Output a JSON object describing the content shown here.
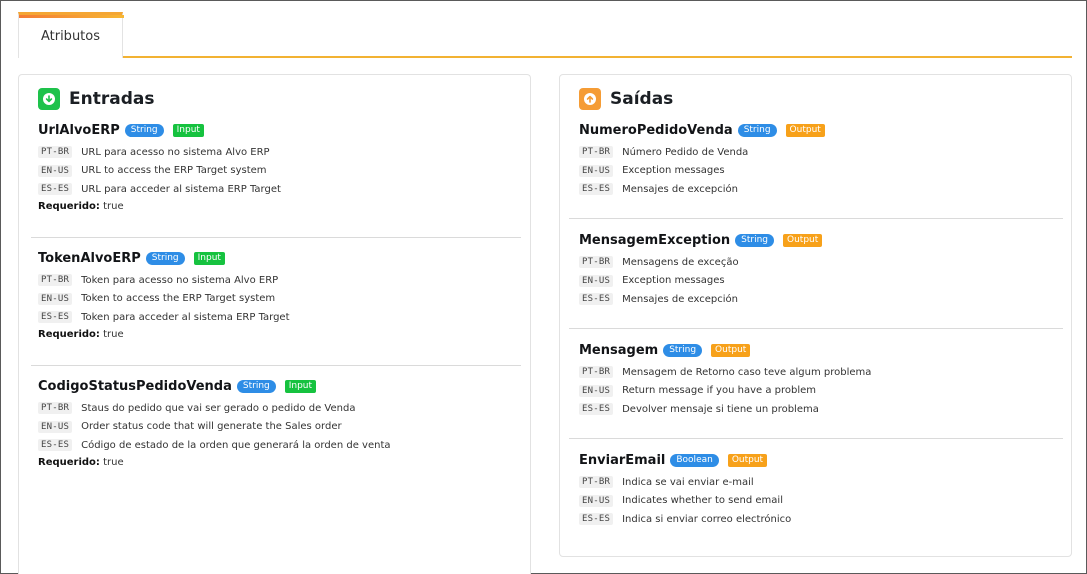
{
  "tabs": [
    {
      "label": "Atributos"
    }
  ],
  "inputs": {
    "title": "Entradas",
    "required_label": "Requerido:",
    "items": [
      {
        "name": "UrlAlvoERP",
        "type": "String",
        "direction": "Input",
        "descriptions": [
          {
            "lang": "PT-BR",
            "text": "URL para acesso no sistema Alvo ERP"
          },
          {
            "lang": "EN-US",
            "text": "URL to access the ERP Target system"
          },
          {
            "lang": "ES-ES",
            "text": "URL para acceder al sistema ERP Target"
          }
        ],
        "required": "true"
      },
      {
        "name": "TokenAlvoERP",
        "type": "String",
        "direction": "Input",
        "descriptions": [
          {
            "lang": "PT-BR",
            "text": "Token para acesso no sistema Alvo ERP"
          },
          {
            "lang": "EN-US",
            "text": "Token to access the ERP Target system"
          },
          {
            "lang": "ES-ES",
            "text": "Token para acceder al sistema ERP Target"
          }
        ],
        "required": "true"
      },
      {
        "name": "CodigoStatusPedidoVenda",
        "type": "String",
        "direction": "Input",
        "descriptions": [
          {
            "lang": "PT-BR",
            "text": "Staus do pedido que vai ser gerado o pedido de Venda"
          },
          {
            "lang": "EN-US",
            "text": "Order status code that will generate the Sales order"
          },
          {
            "lang": "ES-ES",
            "text": "Código de estado de la orden que generará la orden de venta"
          }
        ],
        "required": "true"
      }
    ]
  },
  "outputs": {
    "title": "Saídas",
    "items": [
      {
        "name": "NumeroPedidoVenda",
        "type": "String",
        "direction": "Output",
        "descriptions": [
          {
            "lang": "PT-BR",
            "text": "Número Pedido de Venda"
          },
          {
            "lang": "EN-US",
            "text": "Exception messages"
          },
          {
            "lang": "ES-ES",
            "text": "Mensajes de excepción"
          }
        ]
      },
      {
        "name": "MensagemException",
        "type": "String",
        "direction": "Output",
        "descriptions": [
          {
            "lang": "PT-BR",
            "text": "Mensagens de exceção"
          },
          {
            "lang": "EN-US",
            "text": "Exception messages"
          },
          {
            "lang": "ES-ES",
            "text": "Mensajes de excepción"
          }
        ]
      },
      {
        "name": "Mensagem",
        "type": "String",
        "direction": "Output",
        "descriptions": [
          {
            "lang": "PT-BR",
            "text": "Mensagem de Retorno caso teve algum problema"
          },
          {
            "lang": "EN-US",
            "text": "Return message if you have a problem"
          },
          {
            "lang": "ES-ES",
            "text": "Devolver mensaje si tiene un problema"
          }
        ]
      },
      {
        "name": "EnviarEmail",
        "type": "Boolean",
        "direction": "Output",
        "descriptions": [
          {
            "lang": "PT-BR",
            "text": "Indica se vai enviar e-mail"
          },
          {
            "lang": "EN-US",
            "text": "Indicates whether to send email"
          },
          {
            "lang": "ES-ES",
            "text": "Indica si enviar correo electrónico"
          }
        ]
      }
    ]
  },
  "colors": {
    "tab_accent": "#f4a634",
    "input_icon": "#1ec24b",
    "output_icon": "#f59c35",
    "type_badge": "#2e8de6",
    "input_badge": "#16c23f",
    "output_badge": "#f7a11a"
  },
  "icons": {
    "inputs": "arrow-down-circle-icon",
    "outputs": "arrow-up-circle-icon"
  }
}
